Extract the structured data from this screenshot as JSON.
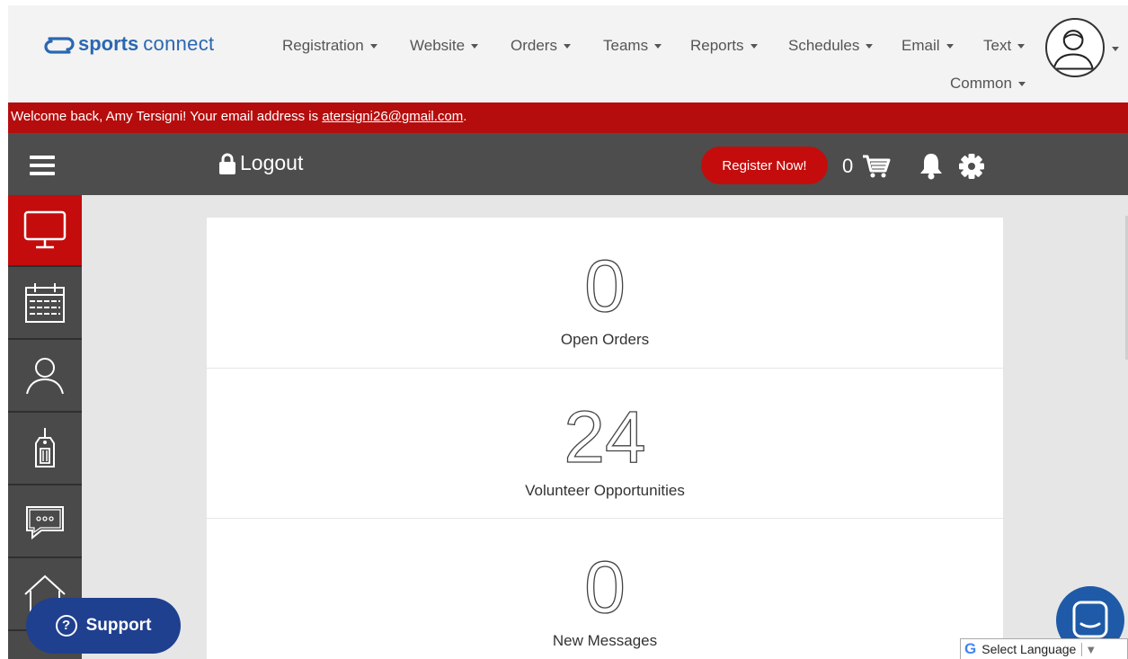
{
  "brand": {
    "name_bold": "sports",
    "name_light": "connect"
  },
  "nav": {
    "items": [
      {
        "label": "Registration"
      },
      {
        "label": "Website"
      },
      {
        "label": "Orders"
      },
      {
        "label": "Teams"
      },
      {
        "label": "Reports"
      },
      {
        "label": "Schedules"
      },
      {
        "label": "Email"
      },
      {
        "label": "Text"
      },
      {
        "label": "Common"
      }
    ]
  },
  "welcome": {
    "prefix": "Welcome back, Amy Tersigni! Your email address is ",
    "email": "atersigni26@gmail.com",
    "suffix": "."
  },
  "toolbar": {
    "logout_label": "Logout",
    "register_label": "Register Now!",
    "cart_count": "0"
  },
  "sidebar": {
    "items": [
      {
        "icon": "monitor-icon",
        "active": true
      },
      {
        "icon": "calendar-icon"
      },
      {
        "icon": "user-icon"
      },
      {
        "icon": "tag-icon"
      },
      {
        "icon": "chat-bubble-icon"
      },
      {
        "icon": "home-icon"
      }
    ]
  },
  "cards": [
    {
      "value": "0",
      "label": "Open Orders"
    },
    {
      "value": "24",
      "label": "Volunteer Opportunities"
    },
    {
      "value": "0",
      "label": "New Messages"
    }
  ],
  "support": {
    "label": "Support"
  },
  "language": {
    "label": "Select Language"
  },
  "colors": {
    "brand_blue": "#2a67b1",
    "accent_red": "#b50d0d",
    "toolbar": "#4d4d4d",
    "support_blue": "#1f3f8f"
  }
}
